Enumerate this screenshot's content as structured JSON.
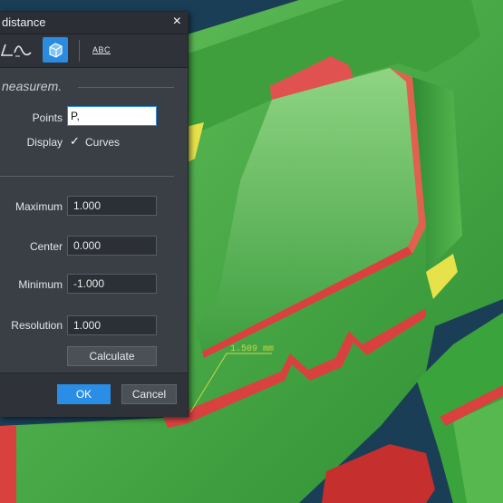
{
  "viewport": {
    "annotation_text": "1.509 mm",
    "colors": {
      "background": "#1b3e57",
      "surface_green": "#3fae3f",
      "deviation_red": "#d9413f",
      "annotation": "#c8d84a"
    }
  },
  "dialog": {
    "title": "distance",
    "close_glyph": "×",
    "toolbar": {
      "tools": [
        "angle-tool",
        "curve-tool",
        "solid-cube-tool",
        "label-abc-tool"
      ],
      "active": "solid-cube-tool",
      "abc_label": "ABC"
    },
    "section_title": "neasurem.",
    "points_label": "Points",
    "points_value": "P,",
    "display_label": "Display",
    "display_checked": true,
    "curves_label": "Curves",
    "maximum_label": "Maximum",
    "maximum_value": "1.000",
    "center_label": "Center",
    "center_value": "0.000",
    "minimum_label": "Minimum",
    "minimum_value": "-1.000",
    "resolution_label": "Resolution",
    "resolution_value": "1.000",
    "calculate_label": "Calculate",
    "ok_label": "OK",
    "cancel_label": "Cancel",
    "accent_color": "#2a8be0"
  }
}
